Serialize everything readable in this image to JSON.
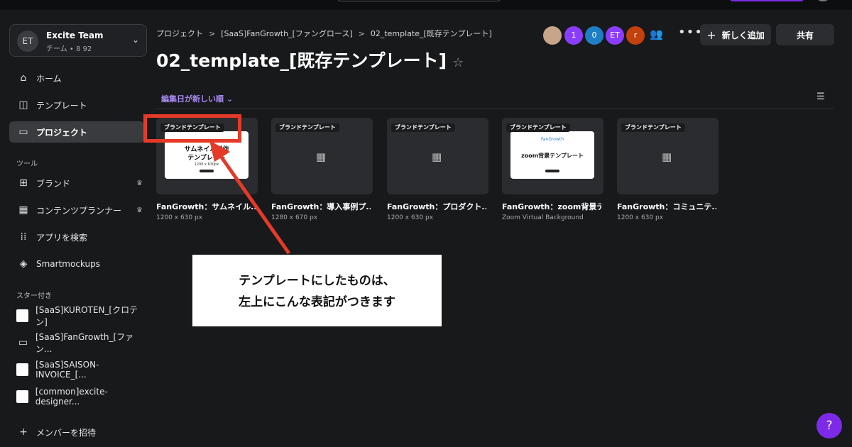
{
  "team": {
    "initials": "ET",
    "name": "Excite Team",
    "sub": "チーム • 8 92"
  },
  "nav": [
    {
      "label": "ホーム",
      "icon": "home-icon"
    },
    {
      "label": "テンプレート",
      "icon": "template-icon"
    },
    {
      "label": "プロジェクト",
      "icon": "folder-icon",
      "active": true
    }
  ],
  "tools_label": "ツール",
  "tools": [
    {
      "label": "ブランド",
      "icon": "brand-icon",
      "crown": true
    },
    {
      "label": "コンテンツプランナー",
      "icon": "calendar-icon",
      "crown": true
    },
    {
      "label": "アプリを検索",
      "icon": "apps-grid-icon"
    },
    {
      "label": "Smartmockups",
      "icon": "layers-icon"
    }
  ],
  "starred_label": "スター付き",
  "starred": [
    {
      "label": "[SaaS]KUROTEN_[クロテン]",
      "kind": "thumb"
    },
    {
      "label": "[SaaS]FanGrowth_[ファン...",
      "kind": "folder"
    },
    {
      "label": "[SaaS]SAISON-INVOICE_[...",
      "kind": "thumb"
    },
    {
      "label": "[common]excite-designer...",
      "kind": "thumb"
    }
  ],
  "invite_label": "メンバーを招待",
  "breadcrumb": {
    "items": [
      "プロジェクト",
      "[SaaS]FanGrowth_[ファングロース]",
      "02_template_[既存テンプレート]"
    ],
    "sep": ">"
  },
  "page_title": "02_template_[既存テンプレート]",
  "star_glyph": "☆",
  "avatars": [
    {
      "text": "",
      "color": "#c7a58a"
    },
    {
      "text": "1",
      "color": "#8b3dff"
    },
    {
      "text": "0",
      "color": "#1f7fc4"
    },
    {
      "text": "ET",
      "color": "#8b3dff"
    },
    {
      "text": "r",
      "color": "#c2410c"
    }
  ],
  "buttons": {
    "new": "新しく追加",
    "share": "共有"
  },
  "sort_label": "編集日が新しい順",
  "cards": [
    {
      "badge": "ブランドテンプレート",
      "title": "FanGrowth：サムネイル...",
      "sub": "1200 x 630 px",
      "preview": "thumbnail",
      "preview_text1": "サムネイル制作",
      "preview_text2": "テンプレート",
      "preview_text3": "1200 x 630px"
    },
    {
      "badge": "ブランドテンプレート",
      "title": "FanGrowth：導入事例プ...",
      "sub": "1280 x 670 px",
      "preview": "grid"
    },
    {
      "badge": "ブランドテンプレート",
      "title": "FanGrowth：プロダクト...",
      "sub": "1200 x 630 px",
      "preview": "grid"
    },
    {
      "badge": "ブランドテンプレート",
      "title": "FanGrowth：zoom背景テ...",
      "sub": "Zoom Virtual Background",
      "preview": "zoom",
      "preview_logo": "FanGrowth",
      "preview_text1": "zoom背景テンプレート"
    },
    {
      "badge": "ブランドテンプレート",
      "title": "FanGrowth：コミュニテ...",
      "sub": "1200 x 630 px",
      "preview": "grid"
    }
  ],
  "callout": {
    "line1": "テンプレートにしたものは、",
    "line2": "左上にこんな表記がつきます"
  },
  "help_label": "?",
  "colors": {
    "accent": "#7d2ae8",
    "annotation": "#e53a28",
    "background": "#18191b"
  }
}
